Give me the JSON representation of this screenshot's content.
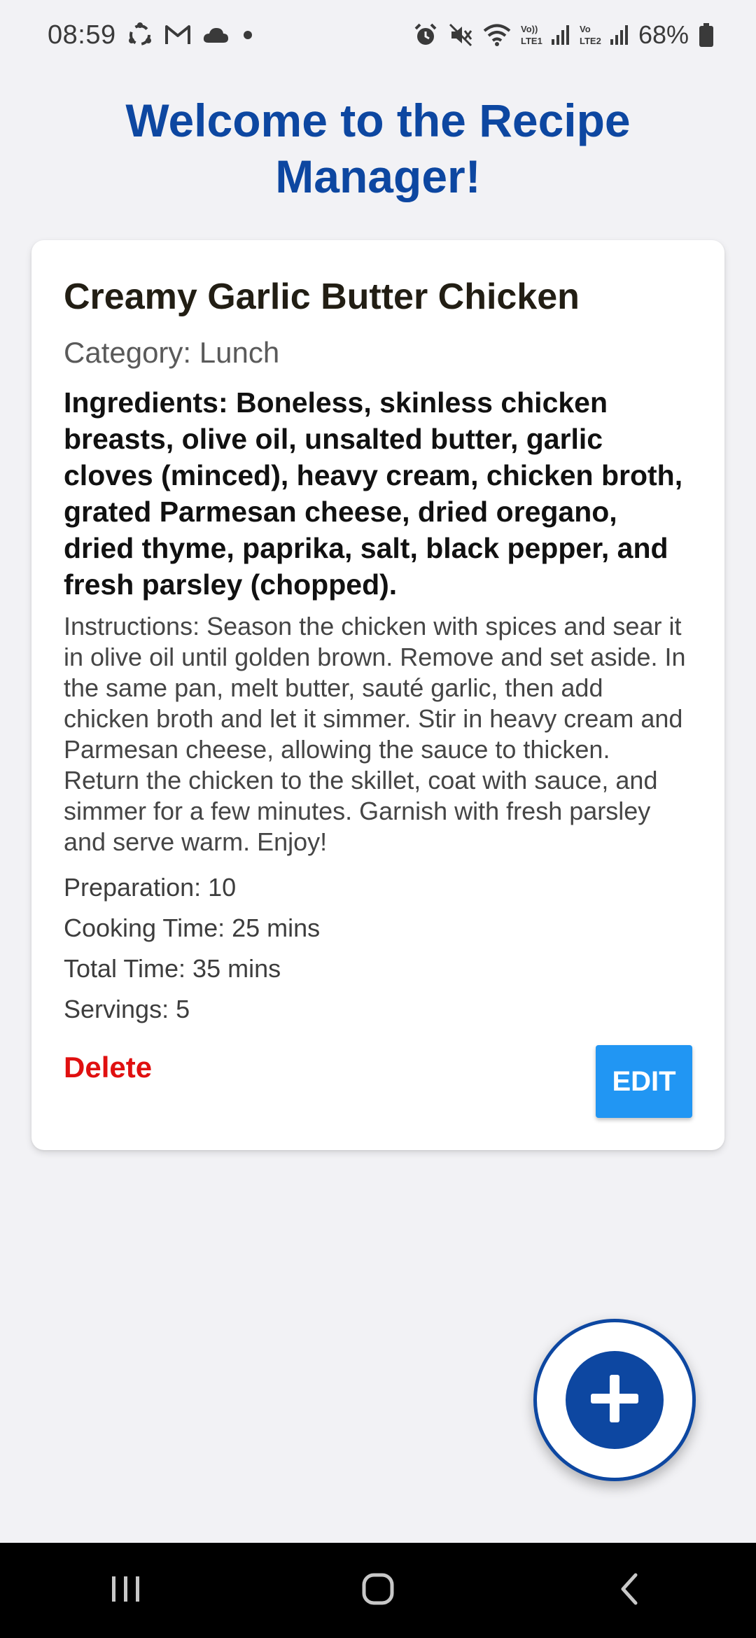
{
  "status_bar": {
    "time": "08:59",
    "battery": "68%",
    "icons_left": [
      "sync-icon",
      "gmail-icon",
      "cloud-icon",
      "dot-icon"
    ],
    "icons_right": [
      "alarm-icon",
      "mute-icon",
      "wifi-icon",
      "volte1-signal-icon",
      "volte2-signal-icon",
      "battery-icon"
    ]
  },
  "header": {
    "title_line1": "Welcome to the Recipe",
    "title_line2": "Manager!",
    "title_color": "#0d47a1"
  },
  "recipe": {
    "name": "Creamy Garlic Butter Chicken",
    "category": "Category: Lunch",
    "ingredients": "Ingredients: Boneless, skinless chicken breasts, olive oil, unsalted butter, garlic cloves (minced), heavy cream, chicken broth, grated Parmesan cheese, dried oregano, dried thyme, paprika, salt, black pepper, and fresh parsley (chopped).",
    "instructions": "Instructions: Season the chicken with spices and sear it in olive oil until golden brown. Remove and set aside. In the same pan, melt butter, sauté garlic, then add chicken broth and let it simmer. Stir in heavy cream and Parmesan cheese, allowing the sauce to thicken. Return the chicken to the skillet, coat with sauce, and simmer for a few minutes. Garnish with fresh parsley and serve warm. Enjoy!",
    "preparation": "Preparation: 10",
    "cooking_time": "Cooking Time: 25 mins",
    "total_time": "Total Time: 35 mins",
    "servings": "Servings: 5",
    "delete_label": "Delete",
    "edit_label": "EDIT"
  },
  "fab": {
    "icon": "plus-icon",
    "accent": "#0d47a1"
  },
  "nav_bar": {
    "items": [
      "recent-apps-icon",
      "home-icon",
      "back-icon"
    ]
  },
  "colors": {
    "background": "#f2f2f5",
    "delete": "#e01010",
    "edit_button": "#2196f3"
  }
}
